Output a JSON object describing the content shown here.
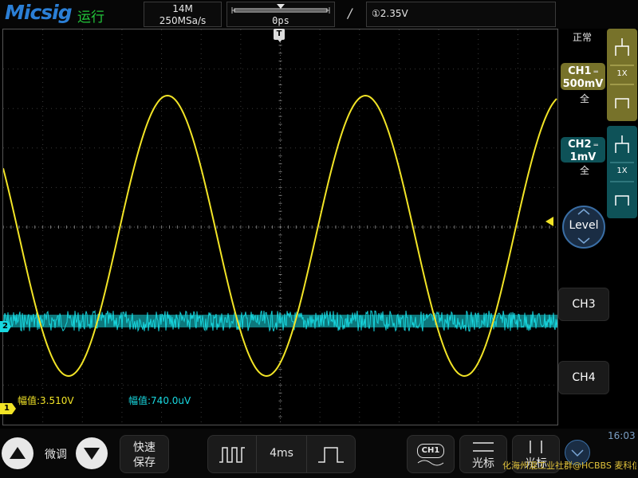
{
  "header": {
    "brand": "Micsig",
    "run_state": "运行",
    "memory_depth": "14M",
    "sample_rate": "250MSa/s",
    "trigger_position": "0ps",
    "trigger_source_icon": "①",
    "trigger_level": "2.35V",
    "trigger_slope_icon": "rising-edge-slope-icon"
  },
  "markers": {
    "trigger_marker": "T",
    "ch1_ground": "1",
    "ch2_ground": "2"
  },
  "measurements": {
    "ch1": "幅值:3.510V",
    "ch2": "幅值:740.0uV"
  },
  "right_panel": {
    "trigger_mode": "正常",
    "ch1": {
      "name": "CH1",
      "scale": "500mV",
      "coupling": "全",
      "probe": "1X"
    },
    "ch2": {
      "name": "CH2",
      "scale": "1mV",
      "coupling": "全",
      "probe": "1X"
    },
    "level_label": "Level",
    "ch3_label": "CH3",
    "ch4_label": "CH4"
  },
  "bottom": {
    "fine_label": "微调",
    "save_label_1": "快速",
    "save_label_2": "保存",
    "timebase": "4ms",
    "ch1_tag": "CH1",
    "cursor_h_label": "光标",
    "cursor_v_label": "光标",
    "clock": "16:03"
  },
  "watermark": "化海州混工业社群@HCBBS 麦科信仪器-小麦",
  "colors": {
    "ch1": "#f2e426",
    "ch2": "#18d8e0",
    "accent_blue": "#2b7fd6",
    "run_green": "#23c43a",
    "ch1_panel": "#77722a",
    "ch2_panel": "#0e5258"
  },
  "waveform": {
    "ch1": {
      "type": "sine",
      "periods_visible": 2.8,
      "amplitude_label": "3.510V"
    },
    "ch2": {
      "type": "noise",
      "amplitude_label": "740.0uV"
    }
  }
}
